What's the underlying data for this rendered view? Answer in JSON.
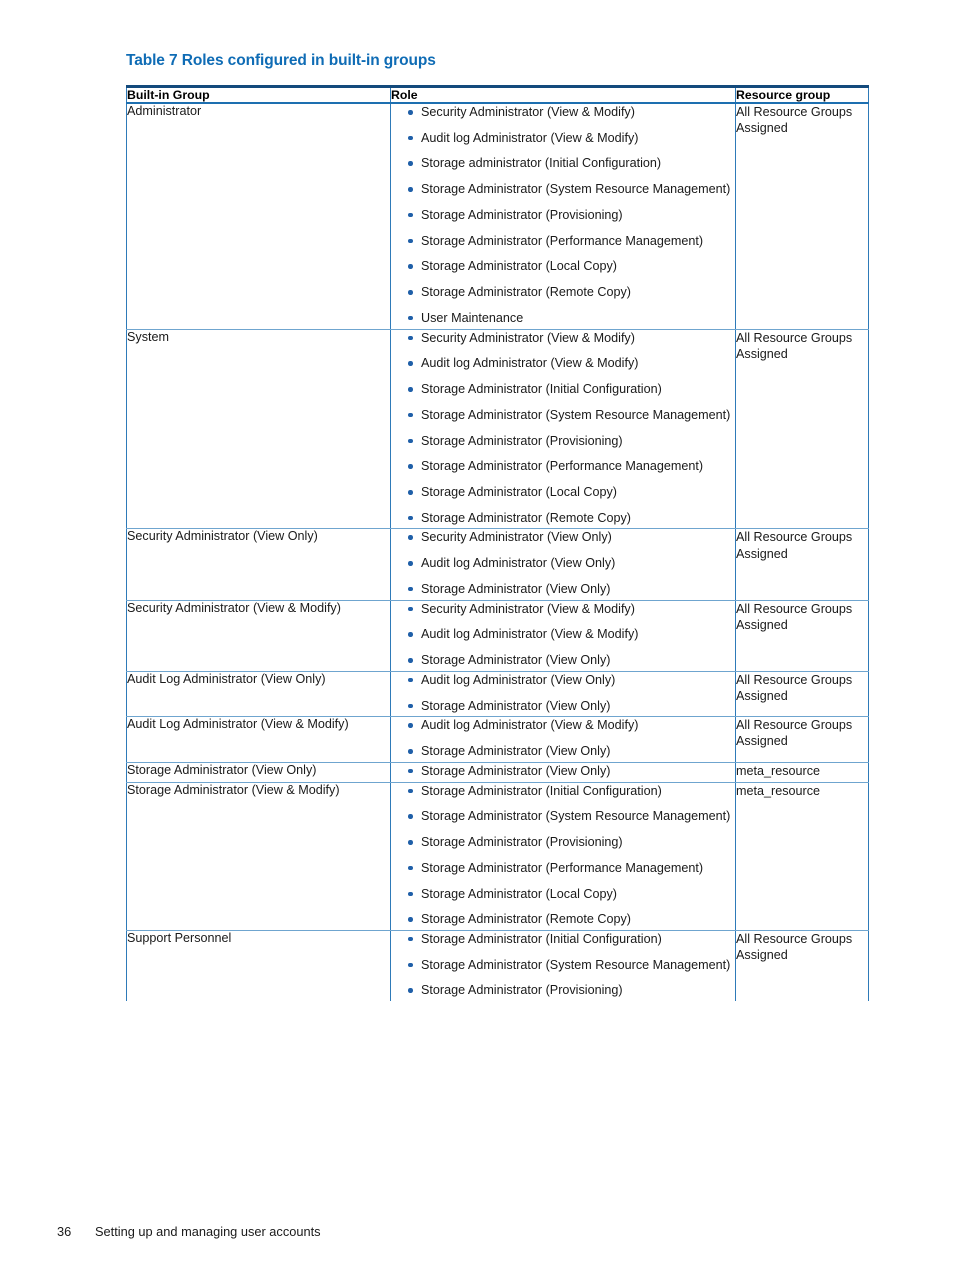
{
  "document": {
    "table_caption": "Table 7 Roles configured in built-in groups",
    "footer": {
      "page_number": "36",
      "section_title": "Setting up and managing user accounts"
    }
  },
  "colors": {
    "caption_blue": "#0f6cb5",
    "header_rule_dark": "#134a7c",
    "border_blue": "#2e7ab8",
    "row_divider": "#6fa5cf",
    "bullet_blue": "#1f5fa8",
    "text": "#1a1a1a"
  },
  "table": {
    "columns": [
      {
        "key": "group",
        "label": "Built-in Group"
      },
      {
        "key": "role",
        "label": "Role"
      },
      {
        "key": "resource",
        "label": "Resource group"
      }
    ],
    "rows": [
      {
        "group": "Administrator",
        "roles": [
          "Security Administrator (View & Modify)",
          "Audit log Administrator (View & Modify)",
          "Storage administrator (Initial Configuration)",
          "Storage Administrator (System Resource Management)",
          "Storage Administrator (Provisioning)",
          "Storage Administrator (Performance Management)",
          "Storage Administrator (Local Copy)",
          "Storage Administrator (Remote Copy)",
          "User Maintenance"
        ],
        "resource": "All Resource Groups Assigned"
      },
      {
        "group": "System",
        "roles": [
          "Security Administrator (View & Modify)",
          "Audit log Administrator (View & Modify)",
          "Storage Administrator (Initial Configuration)",
          "Storage Administrator (System Resource Management)",
          "Storage Administrator (Provisioning)",
          "Storage Administrator (Performance Management)",
          "Storage Administrator (Local Copy)",
          "Storage Administrator (Remote Copy)"
        ],
        "resource": "All Resource Groups Assigned"
      },
      {
        "group": "Security Administrator (View Only)",
        "roles": [
          "Security Administrator (View Only)",
          "Audit log Administrator (View Only)",
          "Storage Administrator (View Only)"
        ],
        "resource": "All Resource Groups Assigned"
      },
      {
        "group": "Security Administrator (View & Modify)",
        "roles": [
          "Security Administrator (View & Modify)",
          "Audit log Administrator (View & Modify)",
          "Storage Administrator (View Only)"
        ],
        "resource": "All Resource Groups Assigned"
      },
      {
        "group": "Audit Log Administrator (View Only)",
        "roles": [
          "Audit log Administrator (View Only)",
          "Storage Administrator (View Only)"
        ],
        "resource": "All Resource Groups Assigned"
      },
      {
        "group": "Audit Log Administrator (View & Modify)",
        "roles": [
          "Audit log Administrator (View & Modify)",
          "Storage Administrator (View Only)"
        ],
        "resource": "All Resource Groups Assigned"
      },
      {
        "group": "Storage Administrator (View Only)",
        "roles": [
          "Storage Administrator (View Only)"
        ],
        "resource": "meta_resource"
      },
      {
        "group": "Storage Administrator (View & Modify)",
        "roles": [
          "Storage Administrator (Initial Configuration)",
          "Storage Administrator (System Resource Management)",
          "Storage Administrator (Provisioning)",
          "Storage Administrator (Performance Management)",
          "Storage Administrator (Local Copy)",
          "Storage Administrator (Remote Copy)"
        ],
        "resource": "meta_resource"
      },
      {
        "group": "Support Personnel",
        "roles": [
          "Storage Administrator (Initial Configuration)",
          "Storage Administrator (System Resource Management)",
          "Storage Administrator (Provisioning)"
        ],
        "resource": "All Resource Groups Assigned"
      }
    ]
  }
}
